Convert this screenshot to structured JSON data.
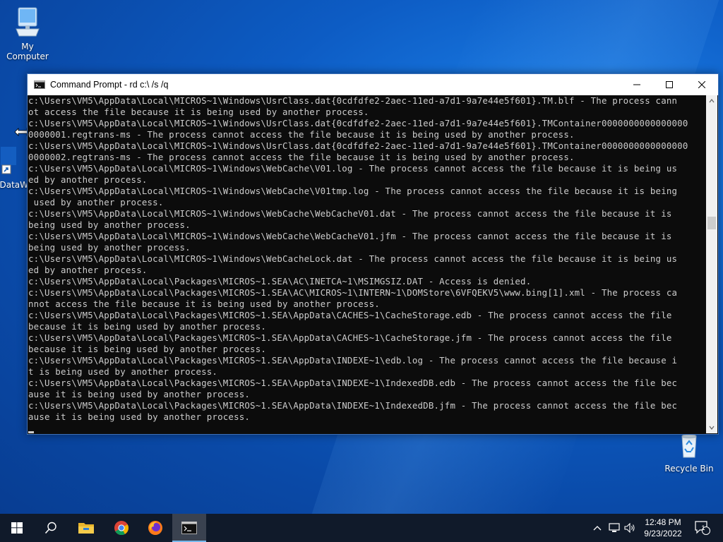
{
  "desktop": {
    "icons": [
      {
        "label": "My Computer"
      },
      {
        "label": "DataW"
      },
      {
        "label": "Recycle Bin"
      }
    ]
  },
  "window": {
    "title": "Command Prompt - rd  c:\\ /s /q",
    "console_lines": [
      "c:\\Users\\VM5\\AppData\\Local\\MICROS~1\\Windows\\UsrClass.dat{0cdfdfe2-2aec-11ed-a7d1-9a7e44e5f601}.TM.blf - The process cann",
      "ot access the file because it is being used by another process.",
      "c:\\Users\\VM5\\AppData\\Local\\MICROS~1\\Windows\\UsrClass.dat{0cdfdfe2-2aec-11ed-a7d1-9a7e44e5f601}.TMContainer0000000000000000",
      "0000001.regtrans-ms - The process cannot access the file because it is being used by another process.",
      "c:\\Users\\VM5\\AppData\\Local\\MICROS~1\\Windows\\UsrClass.dat{0cdfdfe2-2aec-11ed-a7d1-9a7e44e5f601}.TMContainer0000000000000000",
      "0000002.regtrans-ms - The process cannot access the file because it is being used by another process.",
      "c:\\Users\\VM5\\AppData\\Local\\MICROS~1\\Windows\\WebCache\\V01.log - The process cannot access the file because it is being us",
      "ed by another process.",
      "c:\\Users\\VM5\\AppData\\Local\\MICROS~1\\Windows\\WebCache\\V01tmp.log - The process cannot access the file because it is being",
      " used by another process.",
      "c:\\Users\\VM5\\AppData\\Local\\MICROS~1\\Windows\\WebCache\\WebCacheV01.dat - The process cannot access the file because it is",
      "being used by another process.",
      "c:\\Users\\VM5\\AppData\\Local\\MICROS~1\\Windows\\WebCache\\WebCacheV01.jfm - The process cannot access the file because it is",
      "being used by another process.",
      "c:\\Users\\VM5\\AppData\\Local\\MICROS~1\\Windows\\WebCacheLock.dat - The process cannot access the file because it is being us",
      "ed by another process.",
      "c:\\Users\\VM5\\AppData\\Local\\Packages\\MICROS~1.SEA\\AC\\INETCA~1\\MSIMGSIZ.DAT - Access is denied.",
      "c:\\Users\\VM5\\AppData\\Local\\Packages\\MICROS~1.SEA\\AC\\MICROS~1\\INTERN~1\\DOMStore\\6VFQEKV5\\www.bing[1].xml - The process ca",
      "nnot access the file because it is being used by another process.",
      "c:\\Users\\VM5\\AppData\\Local\\Packages\\MICROS~1.SEA\\AppData\\CACHES~1\\CacheStorage.edb - The process cannot access the file",
      "because it is being used by another process.",
      "c:\\Users\\VM5\\AppData\\Local\\Packages\\MICROS~1.SEA\\AppData\\CACHES~1\\CacheStorage.jfm - The process cannot access the file",
      "because it is being used by another process.",
      "c:\\Users\\VM5\\AppData\\Local\\Packages\\MICROS~1.SEA\\AppData\\INDEXE~1\\edb.log - The process cannot access the file because i",
      "t is being used by another process.",
      "c:\\Users\\VM5\\AppData\\Local\\Packages\\MICROS~1.SEA\\AppData\\INDEXE~1\\IndexedDB.edb - The process cannot access the file bec",
      "ause it is being used by another process.",
      "c:\\Users\\VM5\\AppData\\Local\\Packages\\MICROS~1.SEA\\AppData\\INDEXE~1\\IndexedDB.jfm - The process cannot access the file bec",
      "ause it is being used by another process."
    ]
  },
  "taskbar": {
    "items": [
      {
        "icon": "windows-start-icon"
      },
      {
        "icon": "search-icon"
      },
      {
        "icon": "file-explorer-icon"
      },
      {
        "icon": "chrome-icon"
      },
      {
        "icon": "firefox-icon"
      },
      {
        "icon": "command-prompt-icon",
        "active": true
      }
    ],
    "clock": {
      "time": "12:48 PM",
      "date": "9/23/2022"
    },
    "notification_count": "1"
  },
  "colors": {
    "console_bg": "#0c0c0c",
    "console_fg": "#cccccc",
    "taskbar_bg": "#101a2a",
    "active_indicator": "#76b9ed"
  }
}
